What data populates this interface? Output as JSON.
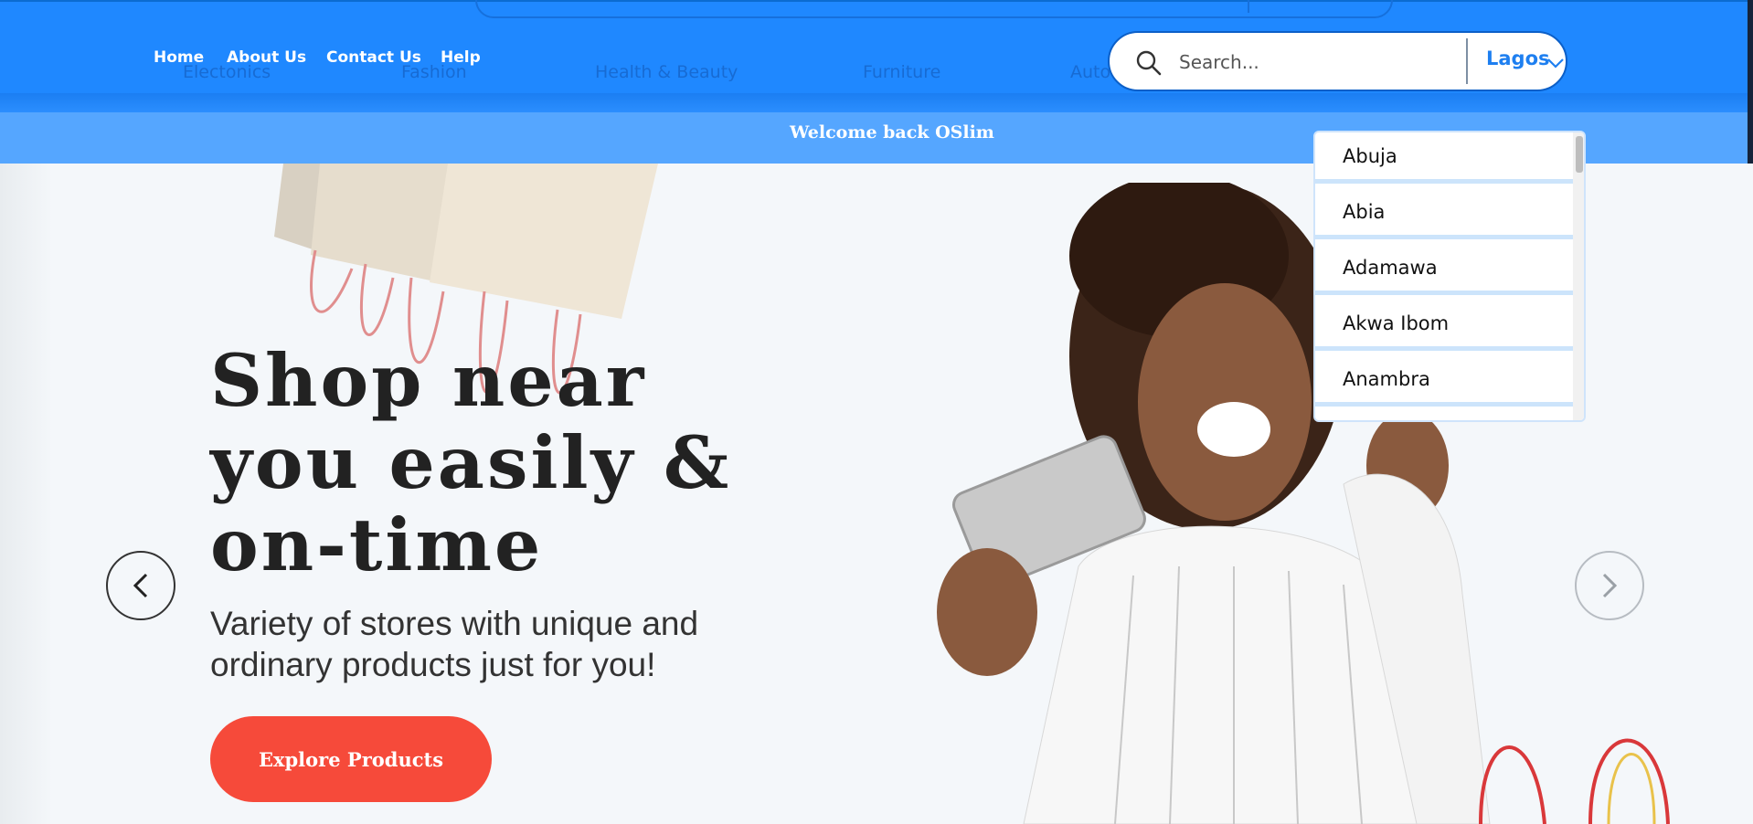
{
  "header": {
    "categories": [
      "Electonics",
      "Fashion",
      "Health & Beauty",
      "Furniture",
      "Auto"
    ],
    "nav": [
      "Home",
      "About Us",
      "Contact Us",
      "Help"
    ],
    "search": {
      "placeholder": "Search...",
      "location": "Lagos"
    }
  },
  "welcome": {
    "text": "Welcome back OSlim"
  },
  "location_dropdown": {
    "items": [
      "Abuja",
      "Abia",
      "Adamawa",
      "Akwa Ibom",
      "Anambra"
    ]
  },
  "hero": {
    "headline": "Shop near you easily & on-time",
    "subtitle": "Variety of stores with unique and ordinary products just for you!",
    "cta": "Explore Products"
  },
  "colors": {
    "header_bg": "#1f88ff",
    "welcome_bg": "#55a6ff",
    "cta_bg": "#f64a3a",
    "accent": "#1e7ff0"
  },
  "icons": [
    "search-icon",
    "chevron-down-icon",
    "chevron-left-icon",
    "chevron-right-icon"
  ]
}
